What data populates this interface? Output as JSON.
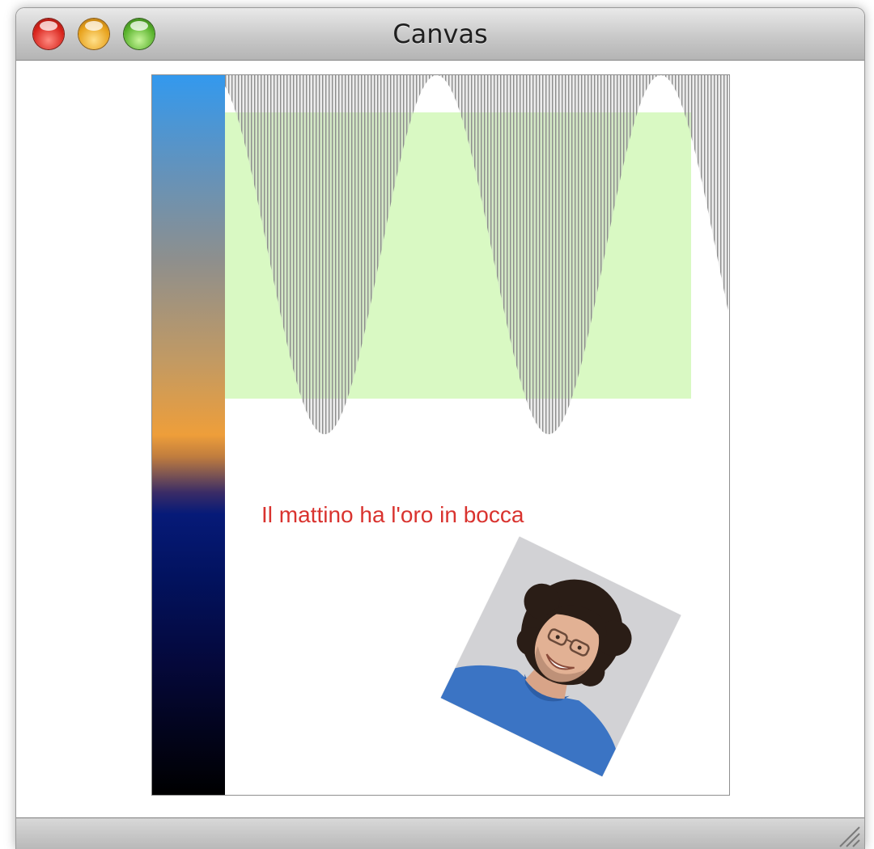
{
  "window": {
    "title": "Canvas",
    "buttons": {
      "close": "close-button",
      "minimize": "minimize-button",
      "zoom": "zoom-button"
    }
  },
  "canvas": {
    "caption": "Il mattino ha l'oro in bocca",
    "caption_color": "#d9332f",
    "fill_color": "#d9f9c3",
    "stripe_color": "#8c8c8c",
    "gradient_colors": [
      "#3399ee",
      "#8f8f8c",
      "#ee9e3a",
      "#061a78",
      "#000000"
    ],
    "photo_icon": "person-photo"
  }
}
